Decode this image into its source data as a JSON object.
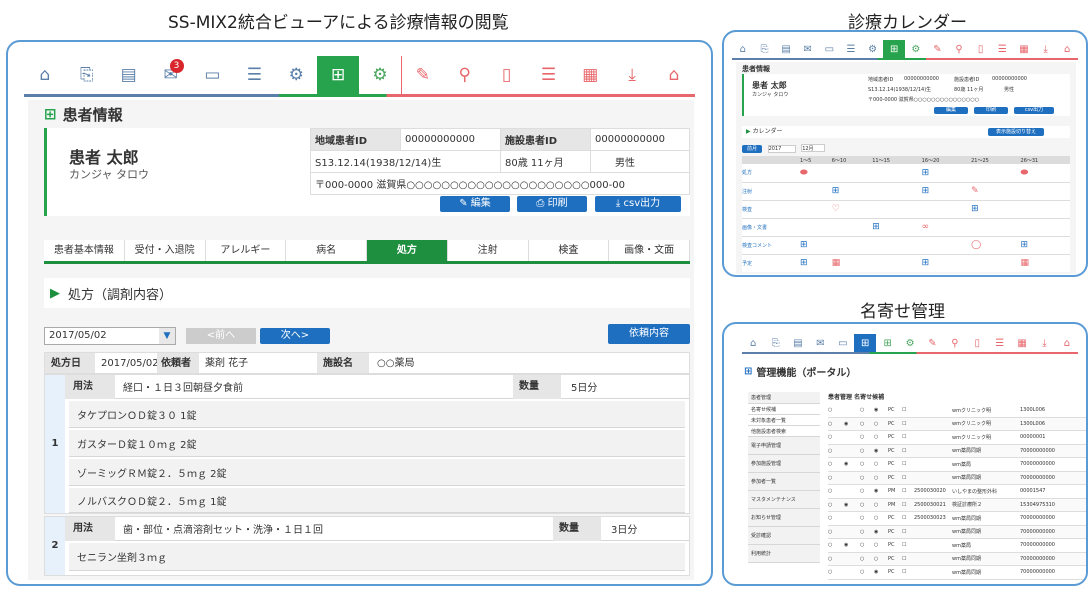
{
  "titles": {
    "main": "SS-MIX2統合ビューアによる診療情報の閲覧",
    "calendar": "診療カレンダー",
    "nayose": "名寄せ管理"
  },
  "main": {
    "badge": "3",
    "section_title": "患者情報",
    "patient": {
      "name": "患者 太郎",
      "kana": "カンジャ タロウ",
      "region_id_label": "地域患者ID",
      "region_id": "00000000000",
      "facility_id_label": "施設患者ID",
      "facility_id": "00000000000",
      "birth": "S13.12.14(1938/12/14)生",
      "age": "80歳 11ヶ月",
      "sex": "男性",
      "address": "〒000-0000 滋賀県○○○○○○○○○○○○○○○○○○○○○000-00"
    },
    "buttons": {
      "edit": "編集",
      "print": "印刷",
      "csv": "csv出力"
    },
    "tabs": [
      "患者基本情報",
      "受付・入退院",
      "アレルギー",
      "病名",
      "処方",
      "注射",
      "検査",
      "画像・文面"
    ],
    "subsection": "処方（調剤内容）",
    "date_value": "2017/05/02",
    "prev": "<前へ",
    "next": "次へ>",
    "request_button": "依頼内容",
    "rx_header": {
      "date_label": "処方日",
      "date": "2017/05/02",
      "requester_label": "依頼者",
      "requester": "薬剤 花子",
      "facility_label": "施設名",
      "facility": "○○薬局"
    },
    "rx1": {
      "no": "1",
      "usage_label": "用法",
      "usage": "経口・１日３回朝昼夕食前",
      "qty_label": "数量",
      "qty": "5日分",
      "drugs": [
        "タケプロンＯＤ錠３０ 1錠",
        "ガスターＤ錠１０ｍｇ 2錠",
        "ゾーミッグＲＭ錠２．５ｍｇ 2錠",
        "ノルバスクＯＤ錠２．５ｍｇ 1錠"
      ]
    },
    "rx2": {
      "no": "2",
      "usage_label": "用法",
      "usage": "歯・部位・点滴溶剤セット・洗浄・１日１回",
      "qty_label": "数量",
      "qty": "3日分",
      "drugs": [
        "セニラン坐剤３ｍｇ"
      ]
    }
  },
  "calendar": {
    "section_title": "患者情報",
    "name": "患者 太郎",
    "kana": "カンジャ タロウ",
    "region_label": "地域患者ID",
    "facility_label": "施設患者ID",
    "region_id": "00000000000",
    "facility_id": "00000000000",
    "birth": "S13.12.14(1938/12/14)生",
    "age": "80歳 11ヶ月",
    "sex": "男性",
    "address": "〒000-0000 滋賀県○○○○○○○○○○○○○○○",
    "btn_edit": "編集",
    "btn_print": "印刷",
    "btn_csv": "csv出力",
    "cal_label": "カレンダー",
    "cal_btn": "表示施設切り替え",
    "year": "2017",
    "month": "12月",
    "prev": "前月",
    "cols": [
      "1～5",
      "6～10",
      "11～15",
      "16～20",
      "21～25",
      "26～31"
    ],
    "rows": [
      "処方",
      "注射",
      "検査",
      "画像・文書",
      "検査コメント",
      "予定"
    ]
  },
  "nayose": {
    "title": "管理機能（ポータル）",
    "side_items": [
      "患者管理",
      "名寄せ候補",
      "未対象患者一覧",
      "他施設患者検索",
      "電子申請管理",
      "参加施設管理",
      "参加者一覧",
      "マスタメンテナンス",
      "お知らせ管理",
      "受診確認",
      "利用統計"
    ],
    "table_heading": "患者管理 名寄せ候補",
    "rows": [
      {
        "type": "PC",
        "code": "",
        "name": "wmクリニック明",
        "id": "1300L006"
      },
      {
        "type": "PC",
        "code": "",
        "name": "wmクリニック明",
        "id": "1300L006"
      },
      {
        "type": "PC",
        "code": "",
        "name": "wmクリニック明",
        "id": "00000001"
      },
      {
        "type": "PC",
        "code": "",
        "name": "wm薬局同期",
        "id": "70000000000"
      },
      {
        "type": "PC",
        "code": "",
        "name": "wm薬局",
        "id": "70000000000"
      },
      {
        "type": "PC",
        "code": "",
        "name": "wm薬局同期",
        "id": "70000000000"
      },
      {
        "type": "PM",
        "code": "2500030020",
        "name": "いしやまの整形外科",
        "id": "00001547"
      },
      {
        "type": "PM",
        "code": "2500030021",
        "name": "検証診療所２",
        "id": "15304975310"
      },
      {
        "type": "PC",
        "code": "2500030023",
        "name": "wm薬局同期",
        "id": "70000000000"
      },
      {
        "type": "PC",
        "code": "",
        "name": "wm薬局同期",
        "id": "70000000000"
      },
      {
        "type": "PC",
        "code": "",
        "name": "wm薬局",
        "id": "70000000000"
      },
      {
        "type": "PC",
        "code": "",
        "name": "wm薬局同期",
        "id": "70000000000"
      },
      {
        "type": "PC",
        "code": "",
        "name": "wm薬局同期",
        "id": "70000000000"
      }
    ]
  }
}
